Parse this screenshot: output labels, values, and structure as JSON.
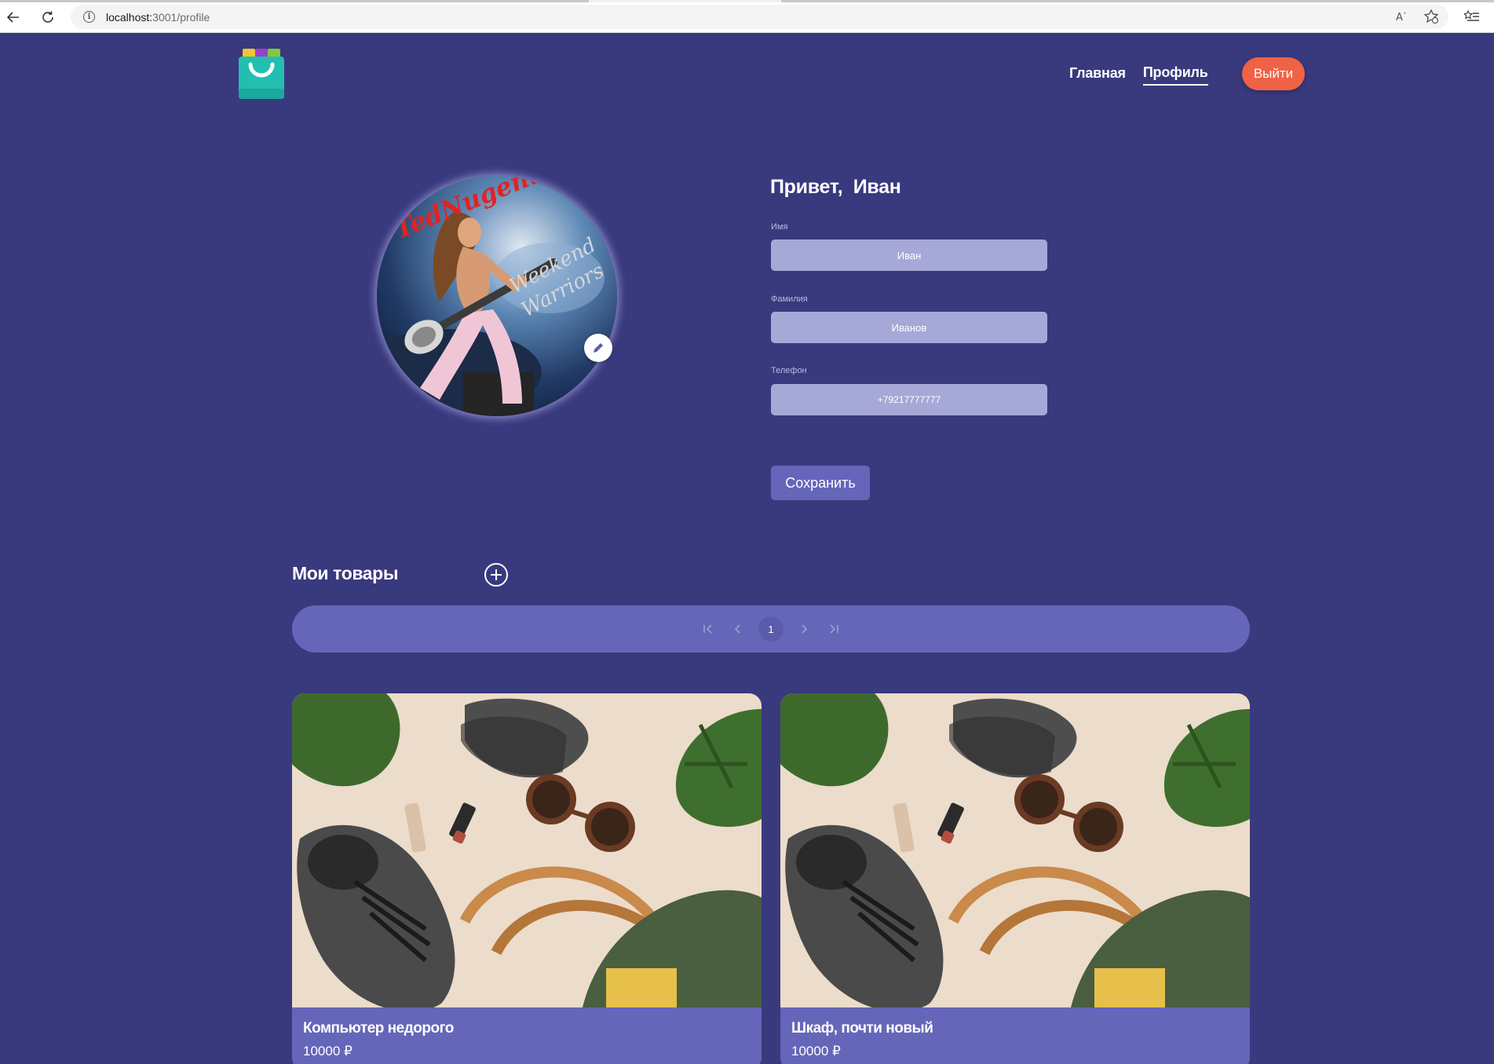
{
  "browser": {
    "url_host": "localhost:",
    "url_path": "3001/profile"
  },
  "header": {
    "nav": [
      {
        "label": "Главная",
        "active": false
      },
      {
        "label": "Профиль",
        "active": true
      }
    ],
    "logout_label": "Выйти"
  },
  "profile": {
    "greeting": "Привет,  Иван",
    "fields": {
      "first_name": {
        "label": "Имя",
        "value": "Иван"
      },
      "last_name": {
        "label": "Фамилия",
        "value": "Иванов"
      },
      "phone": {
        "label": "Телефон",
        "value": "+79217777777"
      }
    },
    "save_label": "Сохранить",
    "avatar_icon": "pencil-icon"
  },
  "goods": {
    "title": "Мои товары",
    "add_icon": "plus-circle-icon",
    "pagination": {
      "current_page": "1",
      "icons": [
        "first-page-icon",
        "prev-page-icon",
        "next-page-icon",
        "last-page-icon"
      ]
    },
    "items": [
      {
        "title": "Компьютер недорого",
        "price": "10000 ₽"
      },
      {
        "title": "Шкаф, почти новый",
        "price": "10000 ₽"
      }
    ]
  },
  "colors": {
    "background": "#39397e",
    "accent": "#6566b9",
    "input": "#a6a8d8",
    "logout": "#f06245"
  }
}
